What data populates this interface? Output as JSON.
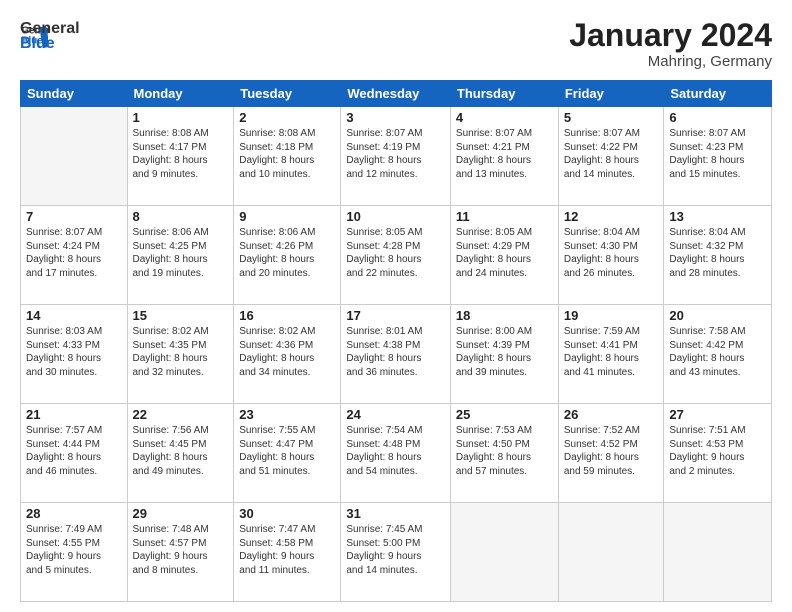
{
  "header": {
    "logo_general": "General",
    "logo_blue": "Blue",
    "month": "January 2024",
    "location": "Mahring, Germany"
  },
  "columns": [
    "Sunday",
    "Monday",
    "Tuesday",
    "Wednesday",
    "Thursday",
    "Friday",
    "Saturday"
  ],
  "weeks": [
    [
      {
        "day": "",
        "info": ""
      },
      {
        "day": "1",
        "info": "Sunrise: 8:08 AM\nSunset: 4:17 PM\nDaylight: 8 hours\nand 9 minutes."
      },
      {
        "day": "2",
        "info": "Sunrise: 8:08 AM\nSunset: 4:18 PM\nDaylight: 8 hours\nand 10 minutes."
      },
      {
        "day": "3",
        "info": "Sunrise: 8:07 AM\nSunset: 4:19 PM\nDaylight: 8 hours\nand 12 minutes."
      },
      {
        "day": "4",
        "info": "Sunrise: 8:07 AM\nSunset: 4:21 PM\nDaylight: 8 hours\nand 13 minutes."
      },
      {
        "day": "5",
        "info": "Sunrise: 8:07 AM\nSunset: 4:22 PM\nDaylight: 8 hours\nand 14 minutes."
      },
      {
        "day": "6",
        "info": "Sunrise: 8:07 AM\nSunset: 4:23 PM\nDaylight: 8 hours\nand 15 minutes."
      }
    ],
    [
      {
        "day": "7",
        "info": "Sunrise: 8:07 AM\nSunset: 4:24 PM\nDaylight: 8 hours\nand 17 minutes."
      },
      {
        "day": "8",
        "info": "Sunrise: 8:06 AM\nSunset: 4:25 PM\nDaylight: 8 hours\nand 19 minutes."
      },
      {
        "day": "9",
        "info": "Sunrise: 8:06 AM\nSunset: 4:26 PM\nDaylight: 8 hours\nand 20 minutes."
      },
      {
        "day": "10",
        "info": "Sunrise: 8:05 AM\nSunset: 4:28 PM\nDaylight: 8 hours\nand 22 minutes."
      },
      {
        "day": "11",
        "info": "Sunrise: 8:05 AM\nSunset: 4:29 PM\nDaylight: 8 hours\nand 24 minutes."
      },
      {
        "day": "12",
        "info": "Sunrise: 8:04 AM\nSunset: 4:30 PM\nDaylight: 8 hours\nand 26 minutes."
      },
      {
        "day": "13",
        "info": "Sunrise: 8:04 AM\nSunset: 4:32 PM\nDaylight: 8 hours\nand 28 minutes."
      }
    ],
    [
      {
        "day": "14",
        "info": "Sunrise: 8:03 AM\nSunset: 4:33 PM\nDaylight: 8 hours\nand 30 minutes."
      },
      {
        "day": "15",
        "info": "Sunrise: 8:02 AM\nSunset: 4:35 PM\nDaylight: 8 hours\nand 32 minutes."
      },
      {
        "day": "16",
        "info": "Sunrise: 8:02 AM\nSunset: 4:36 PM\nDaylight: 8 hours\nand 34 minutes."
      },
      {
        "day": "17",
        "info": "Sunrise: 8:01 AM\nSunset: 4:38 PM\nDaylight: 8 hours\nand 36 minutes."
      },
      {
        "day": "18",
        "info": "Sunrise: 8:00 AM\nSunset: 4:39 PM\nDaylight: 8 hours\nand 39 minutes."
      },
      {
        "day": "19",
        "info": "Sunrise: 7:59 AM\nSunset: 4:41 PM\nDaylight: 8 hours\nand 41 minutes."
      },
      {
        "day": "20",
        "info": "Sunrise: 7:58 AM\nSunset: 4:42 PM\nDaylight: 8 hours\nand 43 minutes."
      }
    ],
    [
      {
        "day": "21",
        "info": "Sunrise: 7:57 AM\nSunset: 4:44 PM\nDaylight: 8 hours\nand 46 minutes."
      },
      {
        "day": "22",
        "info": "Sunrise: 7:56 AM\nSunset: 4:45 PM\nDaylight: 8 hours\nand 49 minutes."
      },
      {
        "day": "23",
        "info": "Sunrise: 7:55 AM\nSunset: 4:47 PM\nDaylight: 8 hours\nand 51 minutes."
      },
      {
        "day": "24",
        "info": "Sunrise: 7:54 AM\nSunset: 4:48 PM\nDaylight: 8 hours\nand 54 minutes."
      },
      {
        "day": "25",
        "info": "Sunrise: 7:53 AM\nSunset: 4:50 PM\nDaylight: 8 hours\nand 57 minutes."
      },
      {
        "day": "26",
        "info": "Sunrise: 7:52 AM\nSunset: 4:52 PM\nDaylight: 8 hours\nand 59 minutes."
      },
      {
        "day": "27",
        "info": "Sunrise: 7:51 AM\nSunset: 4:53 PM\nDaylight: 9 hours\nand 2 minutes."
      }
    ],
    [
      {
        "day": "28",
        "info": "Sunrise: 7:49 AM\nSunset: 4:55 PM\nDaylight: 9 hours\nand 5 minutes."
      },
      {
        "day": "29",
        "info": "Sunrise: 7:48 AM\nSunset: 4:57 PM\nDaylight: 9 hours\nand 8 minutes."
      },
      {
        "day": "30",
        "info": "Sunrise: 7:47 AM\nSunset: 4:58 PM\nDaylight: 9 hours\nand 11 minutes."
      },
      {
        "day": "31",
        "info": "Sunrise: 7:45 AM\nSunset: 5:00 PM\nDaylight: 9 hours\nand 14 minutes."
      },
      {
        "day": "",
        "info": ""
      },
      {
        "day": "",
        "info": ""
      },
      {
        "day": "",
        "info": ""
      }
    ]
  ]
}
